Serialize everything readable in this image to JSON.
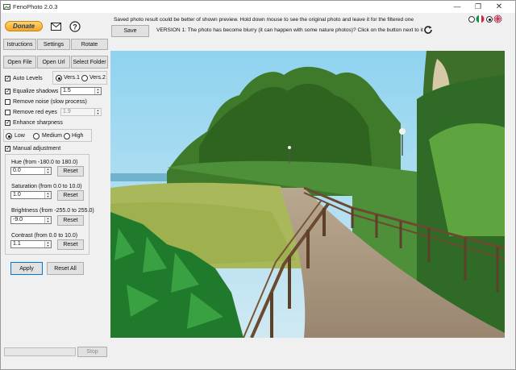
{
  "window": {
    "title": "FenoPhoto 2.0.3"
  },
  "header": {
    "donate_label": "Donate",
    "hint_text": "Saved photo result could be better of shown preview. Hold down mouse to see the original photo and leave it for the filtered one",
    "save_label": "Save",
    "version_text": "VERSION 1: The photo has become blurry (it can happen with some nature photos)? Click on the button next to it"
  },
  "menu_buttons": {
    "instructions": "Istructions",
    "settings": "Settings",
    "rotate": "Rotate"
  },
  "file_buttons": {
    "open_file": "Open File",
    "open_url": "Open Url",
    "select_folder": "Select Folder"
  },
  "options": {
    "auto_levels": {
      "label": "Auto Levels",
      "checked": true
    },
    "version": {
      "v1": "Vers.1",
      "v2": "Vers.2",
      "selected": "Vers.1"
    },
    "equalize_shadows": {
      "label": "Equalize shadows",
      "checked": true,
      "value": "1.5"
    },
    "remove_noise": {
      "label": "Remove noise (slow process)",
      "checked": false
    },
    "remove_red_eyes": {
      "label": "Remove red eyes",
      "checked": false,
      "value": "1.9"
    },
    "enhance_sharpness": {
      "label": "Enhance sharpness",
      "checked": true
    },
    "sharpness": {
      "low": "Low",
      "medium": "Medium",
      "high": "High",
      "selected": "Low"
    },
    "manual_adjustment": {
      "label": "Manual adjustment",
      "checked": true
    }
  },
  "adjustments": [
    {
      "label": "Hue (from -180.0 to 180.0)",
      "value": "0.0",
      "reset": "Reset"
    },
    {
      "label": "Saturation (from 0.0 to 10.0)",
      "value": "1.0",
      "reset": "Reset"
    },
    {
      "label": "Brightness (from -255.0 to 255.0)",
      "value": "-9.0",
      "reset": "Reset"
    },
    {
      "label": "Contrast (from 0.0 to 10.0)",
      "value": "1.1",
      "reset": "Reset"
    }
  ],
  "actions": {
    "apply": "Apply",
    "reset_all": "Reset All",
    "stop": "Stop"
  }
}
